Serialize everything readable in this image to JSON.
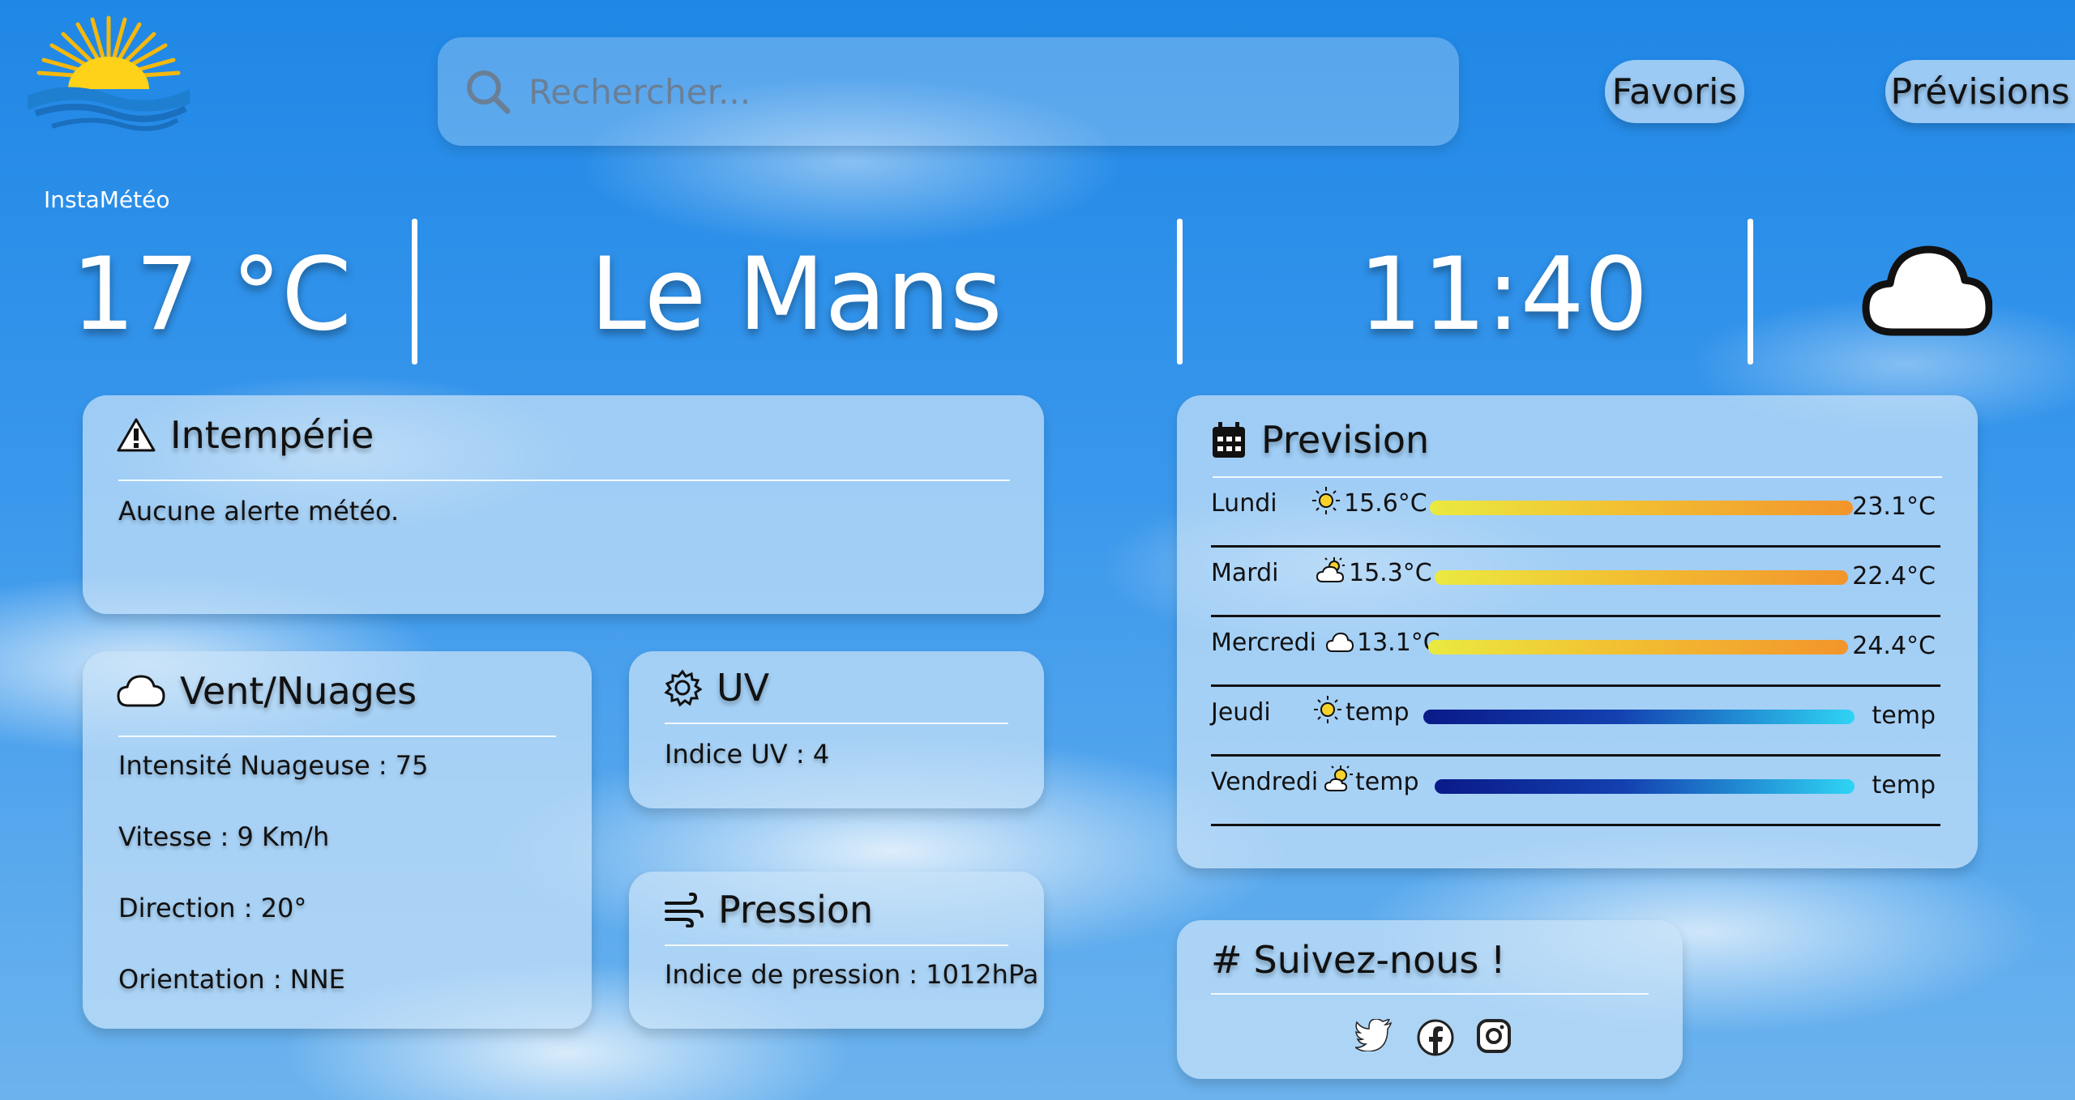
{
  "app": {
    "name": "InstaMétéo"
  },
  "search": {
    "placeholder": "Rechercher..."
  },
  "nav": {
    "favoris": "Favoris",
    "previsions": "Prévisions"
  },
  "current": {
    "temperature": "17 °C",
    "city": "Le Mans",
    "time": "11:40",
    "icon": "cloud-icon"
  },
  "intemperie": {
    "title": "Intempérie",
    "icon": "warning-icon",
    "message": "Aucune alerte météo."
  },
  "vent_nuages": {
    "title": "Vent/Nuages",
    "icon": "cloud-icon",
    "lines": [
      "Intensité Nuageuse : 75",
      "Vitesse : 9 Km/h",
      "Direction : 20°",
      "Orientation : NNE"
    ]
  },
  "uv": {
    "title": "UV",
    "icon": "gear-icon",
    "text": "Indice UV : 4"
  },
  "pression": {
    "title": "Pression",
    "icon": "wind-icon",
    "text": "Indice de pression : 1012hPa"
  },
  "prevision": {
    "title": "Prevision",
    "icon": "calendar-icon",
    "days": [
      {
        "day": "Lundi",
        "icon": "sun-icon",
        "min": "15.6°C",
        "max": "23.1°C",
        "bar": "warm"
      },
      {
        "day": "Mardi",
        "icon": "partly-cloudy-icon",
        "min": "15.3°C",
        "max": "22.4°C",
        "bar": "warm"
      },
      {
        "day": "Mercredi",
        "icon": "cloud-icon",
        "min": "13.1°C",
        "max": "24.4°C",
        "bar": "warm"
      },
      {
        "day": "Jeudi",
        "icon": "sun-icon",
        "min": "temp",
        "max": "temp",
        "bar": "cold"
      },
      {
        "day": "Vendredi",
        "icon": "partly-sunny-icon",
        "min": "temp",
        "max": "temp",
        "bar": "cold"
      }
    ]
  },
  "social": {
    "title": "Suivez-nous !",
    "links": [
      "twitter-icon",
      "facebook-icon",
      "instagram-icon"
    ]
  },
  "colors": {
    "sky": "#2a8ee8",
    "card": "#c8e2f8",
    "warm_bar_start": "#eaea40",
    "warm_bar_end": "#f2952c",
    "cold_bar_start": "#0a1a88",
    "cold_bar_end": "#2fd4f4"
  }
}
